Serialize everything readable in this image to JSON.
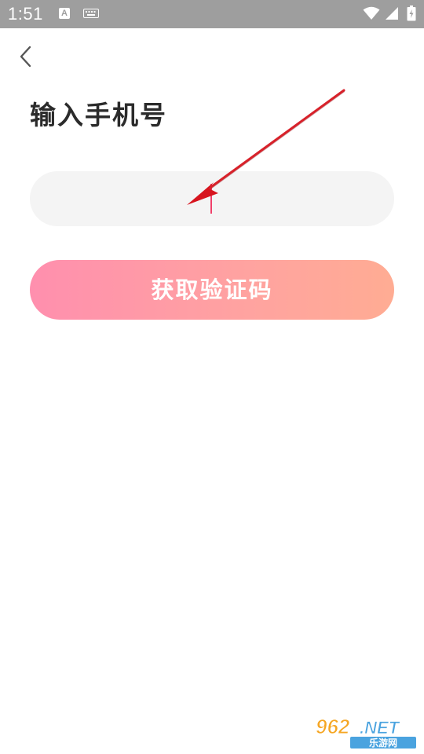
{
  "status_bar": {
    "time": "1:51",
    "notification_letter": "A",
    "icons": [
      "keyboard-icon",
      "wifi-icon",
      "signal-icon",
      "battery-icon"
    ]
  },
  "header": {
    "back_icon": "chevron-left-icon"
  },
  "title": "输入手机号",
  "phone_input": {
    "value": "",
    "placeholder": ""
  },
  "get_code_button": {
    "label": "获取验证码"
  },
  "watermark": {
    "brand": "962.NET",
    "subtitle": "乐游网"
  },
  "colors": {
    "status_bar": "#9e9e9e",
    "title_text": "#2b2b2b",
    "input_background": "#f4f4f4",
    "cursor": "#f0406a",
    "button_gradient_start": "#ff8fae",
    "button_gradient_end": "#ffac93",
    "annotation_arrow": "#d7141e"
  }
}
